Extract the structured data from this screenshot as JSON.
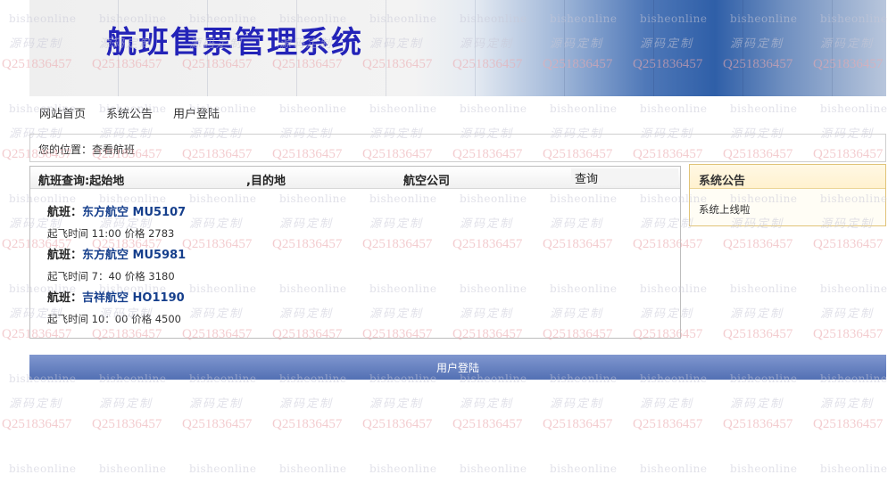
{
  "banner": {
    "title": "航班售票管理系统"
  },
  "nav": {
    "items": [
      {
        "label": "网站首页"
      },
      {
        "label": "系统公告"
      },
      {
        "label": "用户登陆"
      }
    ]
  },
  "breadcrumb": {
    "text": "您的位置：查看航班"
  },
  "search": {
    "origin_label": "航班查询:起始地",
    "destination_label": ",目的地",
    "airline_label": "航空公司",
    "origin_value": "",
    "destination_value": "",
    "airline_value": "",
    "button_label": "查询"
  },
  "flights": [
    {
      "prefix": "航班：",
      "name": "东方航空 MU5107",
      "meta": "起飞时间 11:00 价格 2783"
    },
    {
      "prefix": "航班：",
      "name": "东方航空 MU5981",
      "meta": "起飞时间 7：40 价格 3180"
    },
    {
      "prefix": "航班：",
      "name": "吉祥航空 HO1190",
      "meta": "起飞时间 10：00 价格 4500"
    }
  ],
  "notice": {
    "title": "系统公告",
    "items": [
      {
        "text": "系统上线啦"
      }
    ]
  },
  "footer": {
    "label": "用户登陆"
  },
  "watermark": {
    "site": "bisheonline",
    "slogan": "源码定制",
    "qq": "Q2518364​57"
  },
  "colors": {
    "title": "#2323b8",
    "link": "#163f8c",
    "footer_bar": "#5f7abd",
    "notice_border": "#e0c378"
  }
}
